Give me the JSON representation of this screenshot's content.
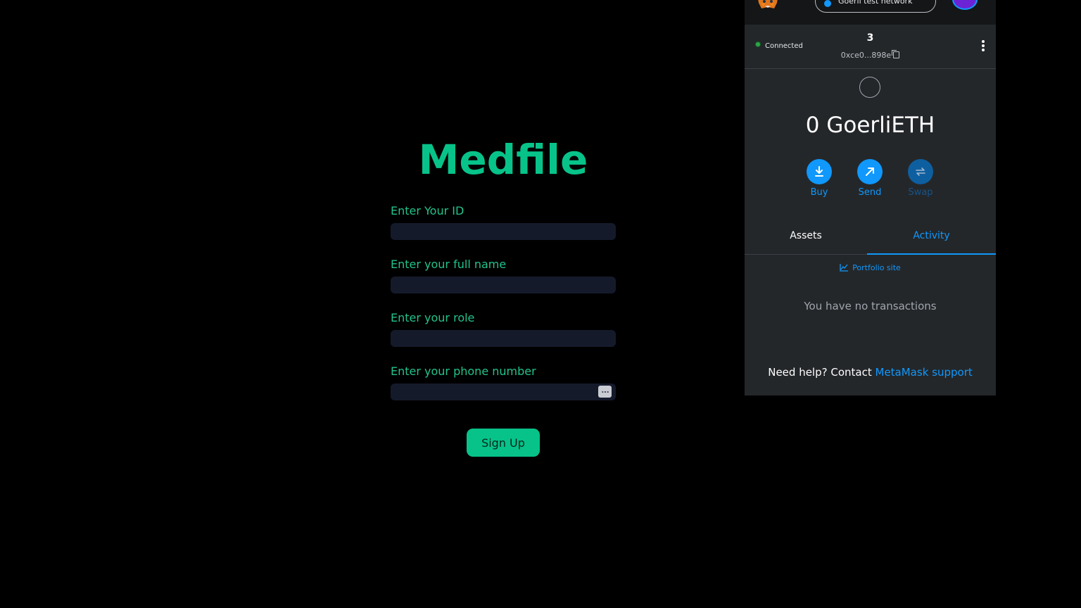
{
  "medfile": {
    "title": "Medfile",
    "fields": [
      {
        "label": "Enter Your ID",
        "value": ""
      },
      {
        "label": "Enter your full name",
        "value": ""
      },
      {
        "label": "Enter your role",
        "value": ""
      },
      {
        "label": "Enter your phone number",
        "value": ""
      }
    ],
    "autofill_icon": "…",
    "signup_label": "Sign Up"
  },
  "metamask": {
    "network": "Goerli test network",
    "status": "Connected",
    "account_name": "3",
    "account_address": "0xce0...898e",
    "balance": "0 GoerliETH",
    "actions": {
      "buy": "Buy",
      "send": "Send",
      "swap": "Swap"
    },
    "tabs": {
      "assets": "Assets",
      "activity": "Activity",
      "active": "activity"
    },
    "portfolio_link": "Portfolio site",
    "empty_state": "You have no transactions",
    "help_prefix": "Need help? Contact",
    "help_link": "MetaMask support"
  },
  "colors": {
    "background": "#000000",
    "medfile_accent": "#07c389",
    "input_bg": "#151a2b",
    "metamask_panel": "#24272a",
    "metamask_blue": "#1098fc"
  },
  "icons": [
    "metamask-fox-icon",
    "network-dot-icon",
    "account-avatar-icon",
    "copy-icon",
    "kebab-menu-icon",
    "token-icon",
    "buy-download-icon",
    "send-arrow-icon",
    "swap-icon",
    "chart-icon",
    "autofill-icon"
  ]
}
